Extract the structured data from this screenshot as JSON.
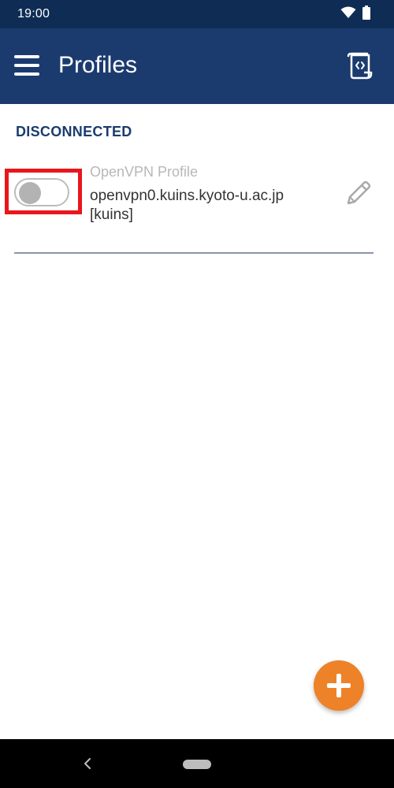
{
  "status_bar": {
    "time": "19:00",
    "icons": [
      "wifi-icon",
      "battery-icon"
    ]
  },
  "app_bar": {
    "title": "Profiles",
    "menu_icon": "menu-icon",
    "import_icon": "import-profile-icon"
  },
  "section": {
    "header": "DISCONNECTED"
  },
  "profile": {
    "type": "OpenVPN Profile",
    "host": "openvpn0.kuins.kyoto-u.ac.jp",
    "name": "[kuins]",
    "connected": false,
    "edit_icon": "pencil-icon"
  },
  "fab": {
    "icon": "plus-icon"
  },
  "nav_bar": {
    "icons": [
      "back-icon",
      "home-pill"
    ]
  },
  "colors": {
    "status_bar": "#0f2c55",
    "app_bar": "#1b3b6f",
    "section_header": "#1b3b6f",
    "highlight": "#e8161d",
    "fab": "#ee8228",
    "divider": "#8696b0"
  }
}
